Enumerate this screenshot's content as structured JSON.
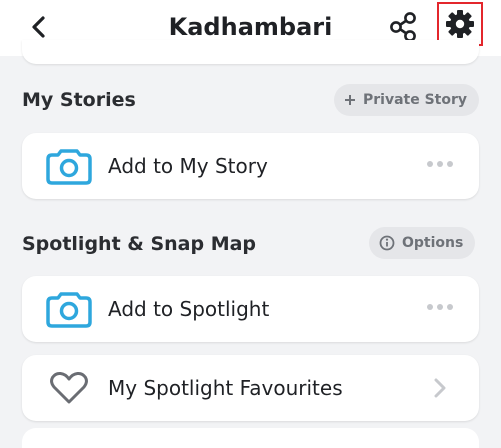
{
  "header": {
    "title": "Kadhambari",
    "back_icon": "chevron-left-icon",
    "share_icon": "share-icon",
    "settings_icon": "gear-icon",
    "settings_highlight_color": "#e3262c"
  },
  "my_stories": {
    "title": "My Stories",
    "action_label": "Private Story",
    "action_icon": "plus-icon",
    "items": [
      {
        "label": "Add to My Story",
        "icon": "camera-icon",
        "trailing": "more-icon"
      }
    ]
  },
  "spotlight": {
    "title": "Spotlight & Snap Map",
    "action_label": "Options",
    "action_icon": "info-icon",
    "items": [
      {
        "label": "Add to Spotlight",
        "icon": "camera-icon",
        "trailing": "more-icon"
      },
      {
        "label": "My Spotlight Favourites",
        "icon": "heart-icon",
        "trailing": "chevron-right-icon"
      }
    ]
  },
  "colors": {
    "accent_blue": "#2ea7dd",
    "background": "#f2f3f5",
    "pill_background": "#e5e6e9"
  }
}
